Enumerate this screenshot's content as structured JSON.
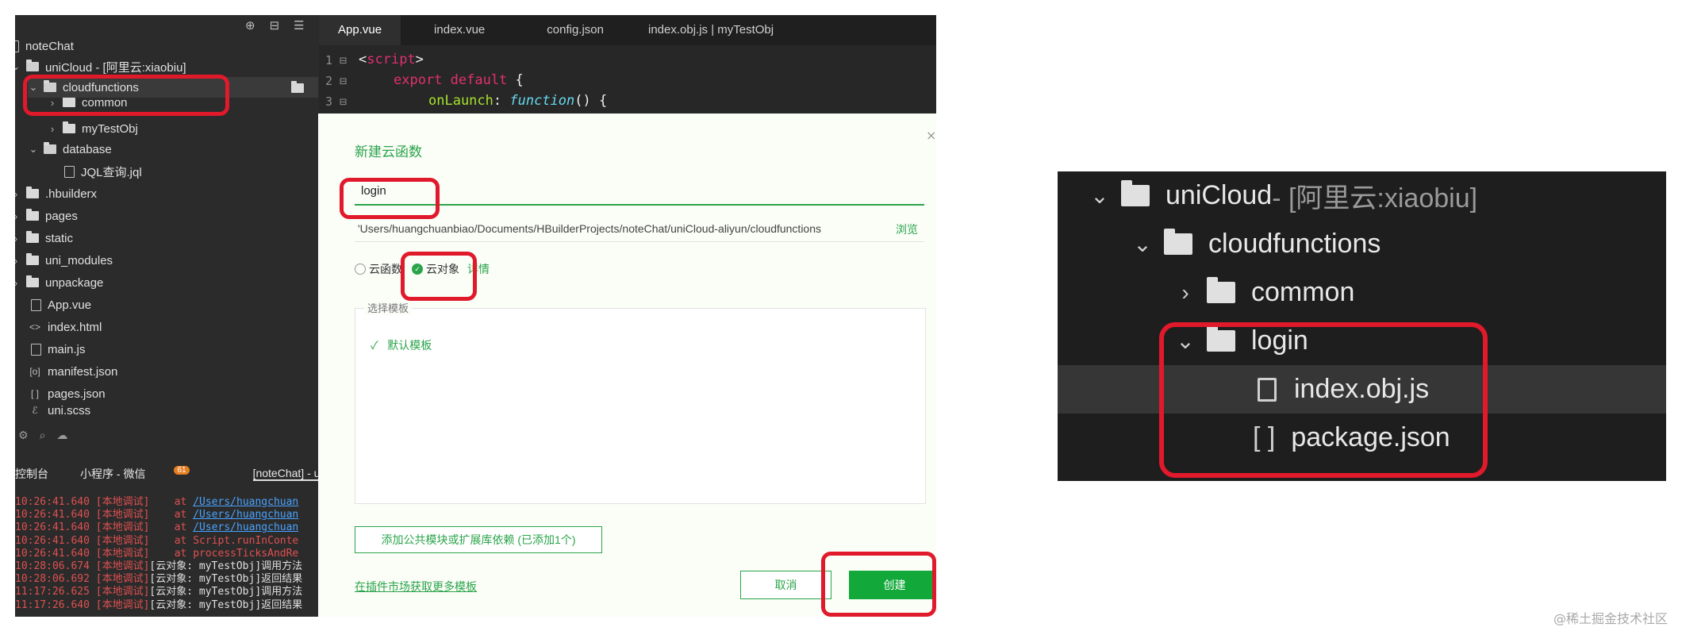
{
  "sidebar": {
    "top_icons": [
      "⊕",
      "⊟",
      "☰"
    ],
    "items": [
      {
        "label": "noteChat"
      },
      {
        "label": "uniCloud - [阿里云:xiaobiu]"
      },
      {
        "label": "cloudfunctions"
      },
      {
        "label": "common"
      },
      {
        "label": "myTestObj"
      },
      {
        "label": "database"
      },
      {
        "label": "JQL查询.jql"
      },
      {
        "label": ".hbuilderx"
      },
      {
        "label": "pages"
      },
      {
        "label": "static"
      },
      {
        "label": "uni_modules"
      },
      {
        "label": "unpackage"
      },
      {
        "label": "App.vue"
      },
      {
        "label": "index.html"
      },
      {
        "label": "main.js"
      },
      {
        "label": "manifest.json"
      },
      {
        "label": "pages.json"
      },
      {
        "label": "uni.scss"
      }
    ]
  },
  "editor": {
    "tabs": [
      "App.vue",
      "index.vue",
      "config.json",
      "index.obj.js | myTestObj"
    ],
    "lines": [
      {
        "num": "1",
        "a": "<",
        "b": "script",
        "c": ">"
      },
      {
        "num": "2",
        "a": "export default",
        "b": " {"
      },
      {
        "num": "3",
        "a": "onLaunch",
        "b": ": ",
        "c": "function",
        "d": "() {"
      }
    ]
  },
  "console": {
    "tabs": [
      "控制台",
      "小程序 - 微信",
      "[noteChat] - uniCl"
    ],
    "badge": "61",
    "lines": [
      {
        "time": "10:26:41.640",
        "tag": "[本地调试]",
        "text": "    at ",
        "link": "/Users/huangchuan",
        "color": "red"
      },
      {
        "time": "10:26:41.640",
        "tag": "[本地调试]",
        "text": "    at ",
        "link": "/Users/huangchuan",
        "color": "red"
      },
      {
        "time": "10:26:41.640",
        "tag": "[本地调试]",
        "text": "    at ",
        "link": "/Users/huangchuan",
        "color": "red"
      },
      {
        "time": "10:26:41.640",
        "tag": "[本地调试]",
        "text": "    at Script.runInConte",
        "link": "",
        "color": "red"
      },
      {
        "time": "10:26:41.640",
        "tag": "[本地调试]",
        "text": "    at processTicksAndRe",
        "link": "",
        "color": "red"
      },
      {
        "time": "10:28:06.674",
        "tag": "[本地调试]",
        "text": "[云对象: myTestObj]调用方法",
        "link": "",
        "color": "white"
      },
      {
        "time": "10:28:06.692",
        "tag": "[本地调试]",
        "text": "[云对象: myTestObj]返回结果",
        "link": "",
        "color": "white"
      },
      {
        "time": "11:17:26.625",
        "tag": "[本地调试]",
        "text": "[云对象: myTestObj]调用方法",
        "link": "",
        "color": "white"
      },
      {
        "time": "11:17:26.640",
        "tag": "[本地调试]",
        "text": "[云对象: myTestObj]返回结果",
        "link": "",
        "color": "white"
      }
    ]
  },
  "dialog": {
    "title": "新建云函数",
    "close": "×",
    "name_value": "login",
    "path_value": "'Users/huangchuanbiao/Documents/HBuilderProjects/noteChat/uniCloud-aliyun/cloudfunctions",
    "browse": "浏览",
    "radio_cloud_function": "云函数",
    "radio_cloud_object": "云对象",
    "detail": "详情",
    "template_legend": "选择模板",
    "template_default": "默认模板",
    "add_dependency": "添加公共模块或扩展库依赖 (已添加1个)",
    "market_link": "在插件市场获取更多模板",
    "cancel": "取消",
    "create": "创建"
  },
  "zoom": {
    "unicloud": "uniCloud",
    "unicloud_suffix": " - [阿里云:xiaobiu]",
    "cloudfunctions": "cloudfunctions",
    "common": "common",
    "login": "login",
    "index_file": "index.obj.js",
    "package_file": "package.json",
    "brackets": "[ ]"
  },
  "watermark": "@稀土掘金技术社区",
  "colors": {
    "accent": "#2aa44a",
    "highlight": "#e0192b"
  }
}
